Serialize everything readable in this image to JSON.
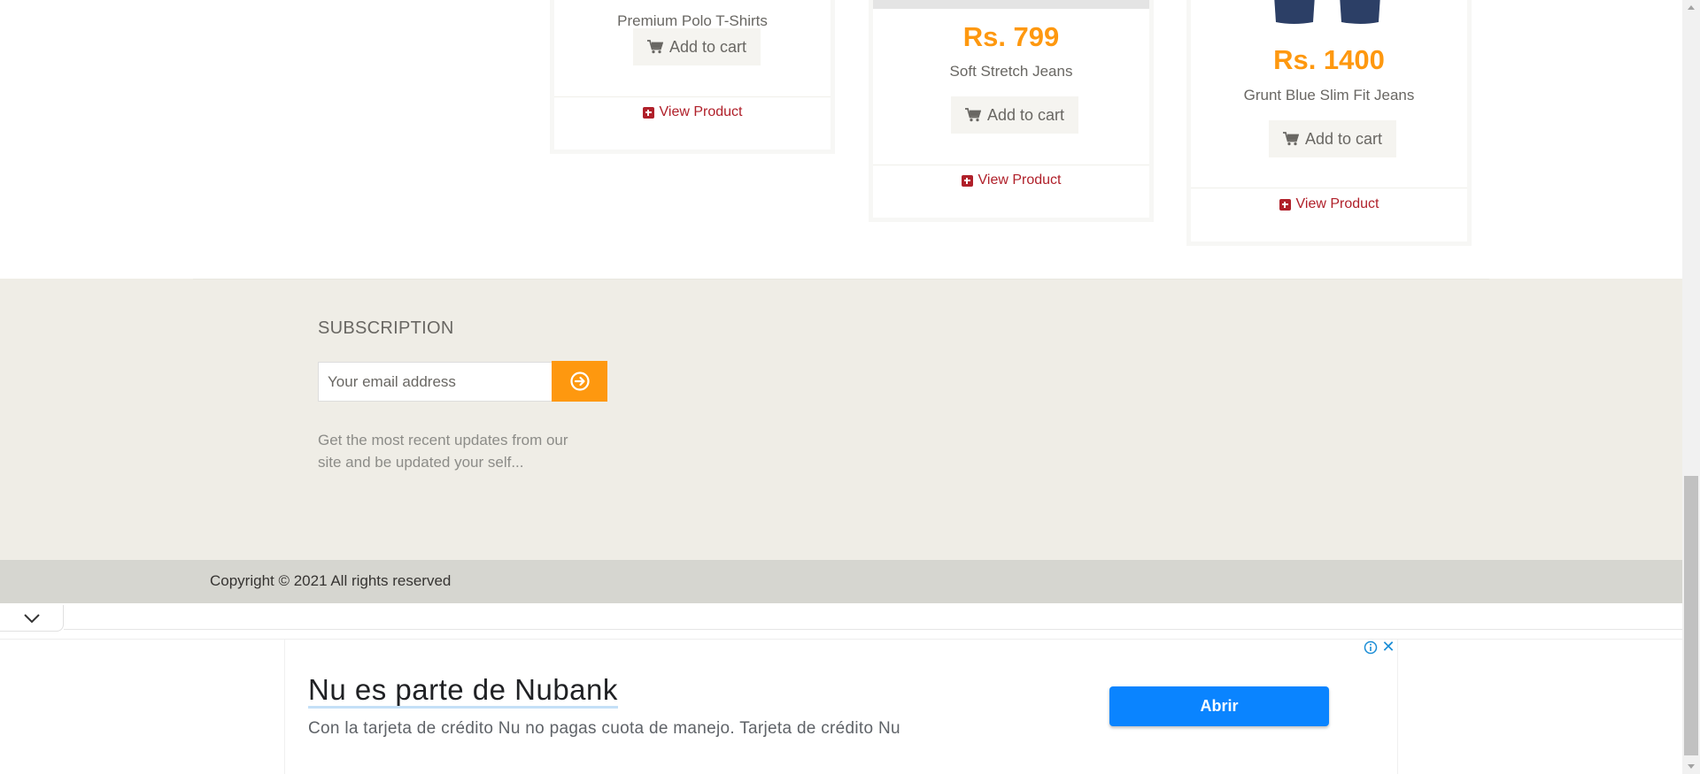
{
  "products": [
    {
      "name": "Premium Polo T-Shirts",
      "price": "",
      "cart_label": "Add to cart",
      "view_label": "View Product"
    },
    {
      "name": "Soft Stretch Jeans",
      "price": "Rs. 799",
      "cart_label": "Add to cart",
      "view_label": "View Product"
    },
    {
      "name": "Grunt Blue Slim Fit Jeans",
      "price": "Rs. 1400",
      "cart_label": "Add to cart",
      "view_label": "View Product"
    }
  ],
  "subscription": {
    "title": "SUBSCRIPTION",
    "email_placeholder": "Your email address",
    "description": "Get the most recent updates from our site and be updated your self..."
  },
  "footer": {
    "copyright": "Copyright © 2021 All rights reserved"
  },
  "ad": {
    "headline": "Nu es parte de Nubank",
    "body": "Con la tarjeta de crédito Nu no pagas cuota de manejo. Tarjeta de crédito Nu",
    "cta": "Abrir",
    "close_glyph": "✕"
  },
  "colors": {
    "accent": "#fe980f",
    "link": "#b0202a",
    "ad_button": "#0a84ff"
  },
  "icons": [
    "shopping-cart-icon",
    "plus-square-icon",
    "arrow-circle-right-icon",
    "chevron-down-icon",
    "info-icon",
    "close-icon"
  ]
}
